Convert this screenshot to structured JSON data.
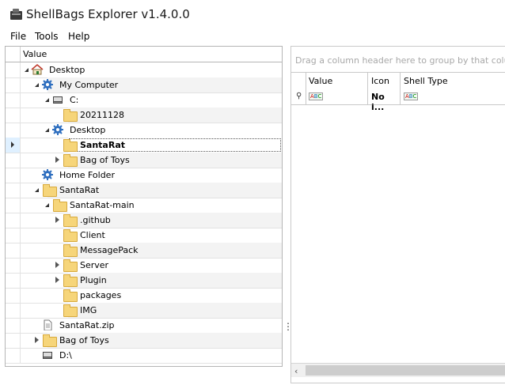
{
  "window": {
    "title": "ShellBags Explorer v1.4.0.0"
  },
  "menu": [
    "File",
    "Tools",
    "Help"
  ],
  "tree": {
    "header": "Value",
    "rows": [
      {
        "label": "Desktop",
        "level": 0,
        "icon": "home-icon",
        "expander": "open",
        "alt": false
      },
      {
        "label": "My Computer",
        "level": 1,
        "icon": "gear-icon",
        "expander": "open",
        "alt": true
      },
      {
        "label": "C:",
        "level": 2,
        "icon": "drive-icon",
        "expander": "open",
        "alt": false
      },
      {
        "label": "20211128",
        "level": 3,
        "icon": "folder-icon",
        "expander": "none",
        "alt": true
      },
      {
        "label": "Desktop",
        "level": 2,
        "icon": "gear-icon",
        "expander": "open",
        "alt": false
      },
      {
        "label": "SantaRat",
        "level": 3,
        "icon": "folder-icon",
        "expander": "none",
        "alt": false,
        "selected": true,
        "bold": true
      },
      {
        "label": "Bag of Toys",
        "level": 3,
        "icon": "folder-icon",
        "expander": "closed",
        "alt": true
      },
      {
        "label": "Home Folder",
        "level": 1,
        "icon": "gear-icon",
        "expander": "none",
        "alt": false
      },
      {
        "label": "SantaRat",
        "level": 1,
        "icon": "folder-icon",
        "expander": "open",
        "alt": true
      },
      {
        "label": "SantaRat-main",
        "level": 2,
        "icon": "folder-icon",
        "expander": "open",
        "alt": false
      },
      {
        "label": ".github",
        "level": 3,
        "icon": "folder-icon",
        "expander": "closed",
        "alt": true
      },
      {
        "label": "Client",
        "level": 3,
        "icon": "folder-icon",
        "expander": "none",
        "alt": false
      },
      {
        "label": "MessagePack",
        "level": 3,
        "icon": "folder-icon",
        "expander": "none",
        "alt": true
      },
      {
        "label": "Server",
        "level": 3,
        "icon": "folder-icon",
        "expander": "closed",
        "alt": false
      },
      {
        "label": "Plugin",
        "level": 3,
        "icon": "folder-icon",
        "expander": "closed",
        "alt": true
      },
      {
        "label": "packages",
        "level": 3,
        "icon": "folder-icon",
        "expander": "none",
        "alt": false
      },
      {
        "label": "IMG",
        "level": 3,
        "icon": "folder-icon",
        "expander": "none",
        "alt": true
      },
      {
        "label": "SantaRat.zip",
        "level": 1,
        "icon": "file-icon",
        "expander": "none",
        "alt": false
      },
      {
        "label": "Bag of Toys",
        "level": 1,
        "icon": "folder-icon",
        "expander": "closed",
        "alt": true
      },
      {
        "label": "D:\\",
        "level": 1,
        "icon": "drive-icon",
        "expander": "none",
        "alt": false
      }
    ]
  },
  "grid": {
    "group_hint": "Drag a column header here to group by that column",
    "columns": [
      "Value",
      "Icon",
      "Shell Type"
    ],
    "filter_row": {
      "icon_value": "No i..."
    }
  }
}
